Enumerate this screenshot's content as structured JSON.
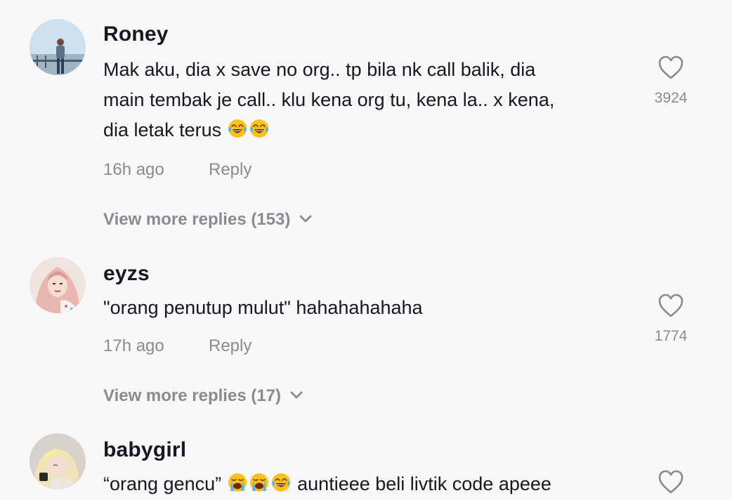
{
  "comments": [
    {
      "username": "Roney",
      "avatar": "avatar-man-standing",
      "lines": [
        "Mak aku, dia x save no org.. tp bila nk call balik, dia",
        "main tembak je call.. klu kena org tu, kena la.. x kena,",
        "dia letak terus"
      ],
      "emojis": [
        "tears-of-joy-emoji",
        "tears-of-joy-emoji"
      ],
      "time": "16h ago",
      "reply_label": "Reply",
      "likes": "3924",
      "view_more": "View more replies (153)"
    },
    {
      "username": "eyzs",
      "avatar": "avatar-woman-hijab",
      "lines": [
        "\"orang penutup mulut\" hahahahahaha"
      ],
      "time": "17h ago",
      "reply_label": "Reply",
      "likes": "1774",
      "view_more": "View more replies (17)"
    },
    {
      "username": "babygirl",
      "avatar": "avatar-blonde-girl",
      "lines_before_emoji": "“orang gencu”",
      "emojis": [
        "loudly-crying-emoji",
        "loudly-crying-emoji",
        "tears-of-joy-emoji"
      ],
      "lines_after_emoji": "auntieee beli livtik code apeee"
    }
  ],
  "colors": {
    "background": "#f8f8f8",
    "text": "#161823",
    "muted": "#8a8b91"
  },
  "icons": {
    "like": "heart-outline-icon",
    "expand": "chevron-down-icon"
  }
}
